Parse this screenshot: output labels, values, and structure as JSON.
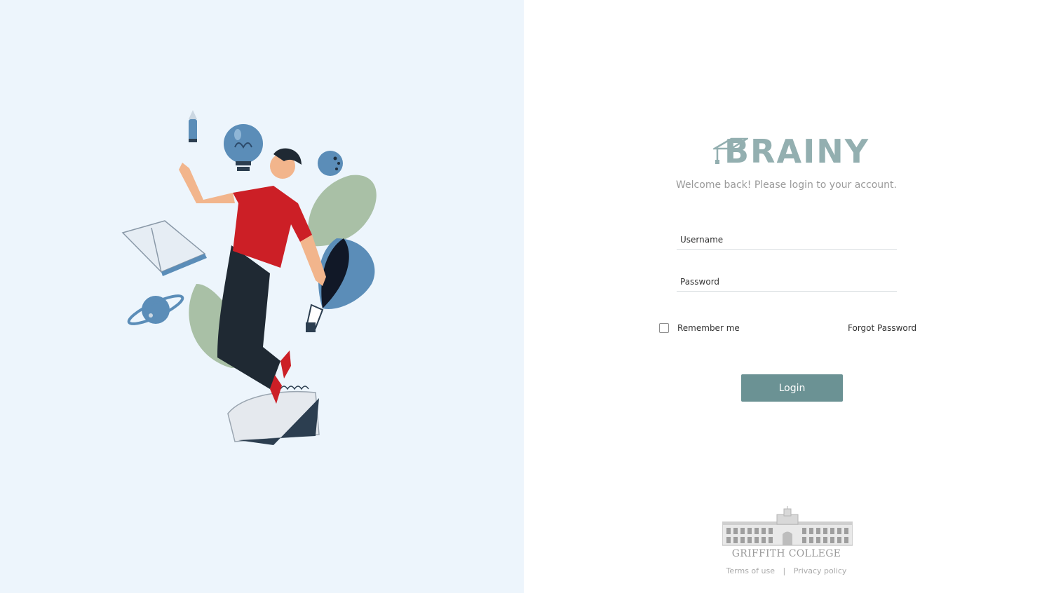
{
  "brand": {
    "name": "BRAINY",
    "tagline": "Welcome back! Please login to your account."
  },
  "form": {
    "username_placeholder": "Username",
    "password_placeholder": "Password",
    "remember_label": "Remember me",
    "forgot_label": "Forgot Password",
    "login_label": "Login"
  },
  "footer": {
    "college_name": "GRIFFITH COLLEGE",
    "terms": "Terms of use",
    "separator": "|",
    "privacy": "Privacy policy"
  },
  "colors": {
    "left_panel_bg": "#edf5fc",
    "brand_text": "#93afb0",
    "login_button": "#6b9294",
    "shirt_red": "#cc1f26",
    "accent_blue": "#5b8db8",
    "leaf_green": "#a9c0a6"
  },
  "icons": [
    "graduation-cap-icon",
    "college-building-icon",
    "checkbox-icon"
  ]
}
